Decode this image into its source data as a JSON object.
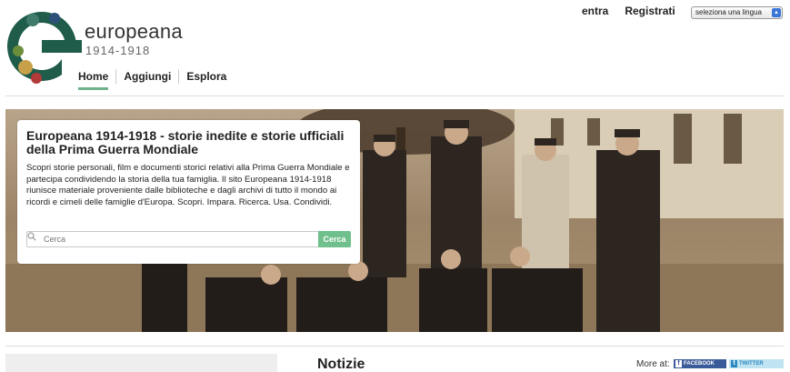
{
  "header": {
    "brand_name": "europeana",
    "brand_years": "1914-1918",
    "login_label": "entra",
    "register_label": "Registrati",
    "language_select": "seleziona una lingua"
  },
  "nav": {
    "items": [
      {
        "label": "Home",
        "active": true
      },
      {
        "label": "Aggiungi",
        "active": false
      },
      {
        "label": "Esplora",
        "active": false
      }
    ]
  },
  "hero": {
    "title": "Europeana 1914-1918 - storie inedite e storie ufficiali della Prima Guerra Mondiale",
    "text": "Scopri storie personali, film e documenti storici relativi alla Prima Guerra Mondiale e partecipa condividendo la storia della tua famiglia. Il sito Europeana 1914-1918 riunisce materiale proveniente dalle biblioteche e dagli archivi di tutto il mondo ai ricordi e cimeli delle famiglie d'Europa. Scopri. Impara. Ricerca. Usa. Condividi.",
    "search_placeholder": "Cerca",
    "search_button": "Cerca"
  },
  "news": {
    "heading": "Notizie",
    "more_at": "More at:",
    "facebook_label": "FACEBOOK",
    "twitter_label": "TWITTER"
  },
  "colors": {
    "accent": "#6fc08c",
    "facebook": "#3b5a99",
    "twitter": "#bfe3f1"
  }
}
